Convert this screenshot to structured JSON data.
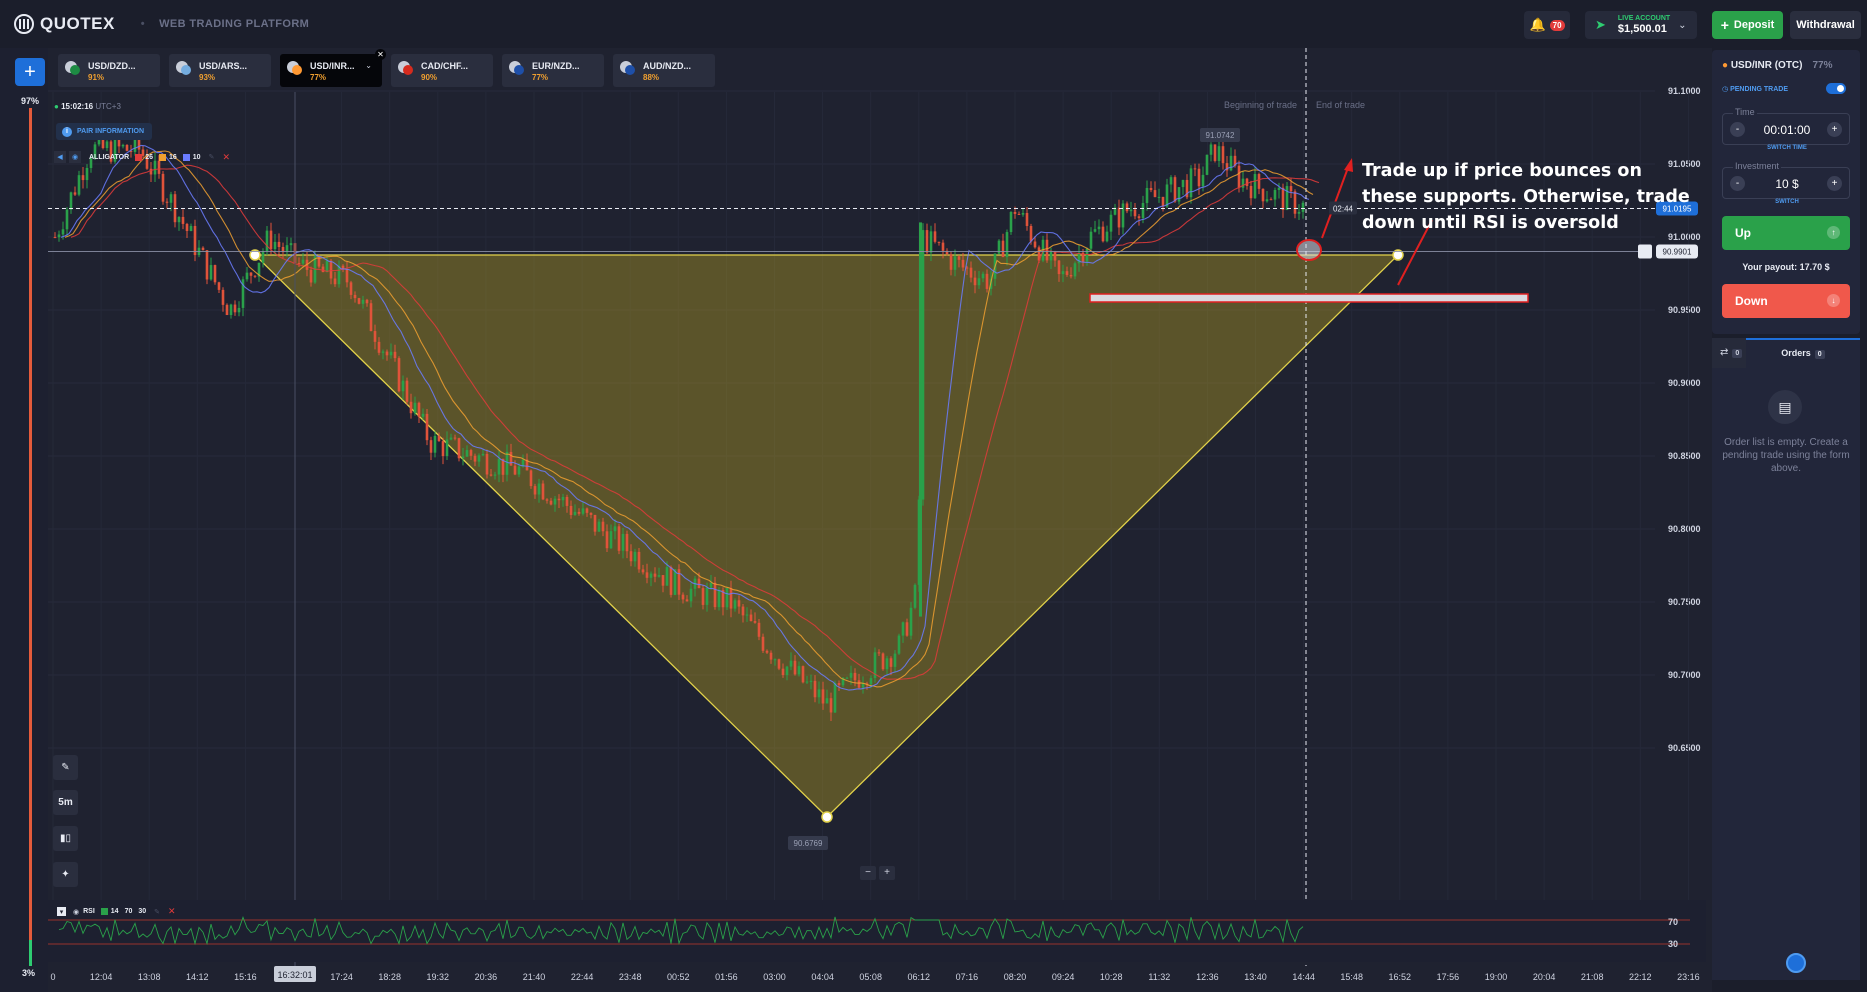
{
  "header": {
    "logo_text": "QUOTEX",
    "platform": "WEB TRADING PLATFORM",
    "notifications_count": "70",
    "account_label": "LIVE ACCOUNT",
    "balance": "$1,500.01",
    "deposit_label": "Deposit",
    "withdrawal_label": "Withdrawal"
  },
  "sentiment": {
    "top": "97%",
    "bottom": "3%"
  },
  "tabs": [
    {
      "name": "USD/DZD...",
      "payout": "91%",
      "flag_color": "#1d8b43"
    },
    {
      "name": "USD/ARS...",
      "payout": "93%",
      "flag_color": "#74acdf"
    },
    {
      "name": "USD/INR...",
      "payout": "77%",
      "flag_color": "#ff9933",
      "active": true
    },
    {
      "name": "CAD/CHF...",
      "payout": "90%",
      "flag_color": "#d52b1e"
    },
    {
      "name": "EUR/NZD...",
      "payout": "77%",
      "flag_color": "#1e4fa8"
    },
    {
      "name": "AUD/NZD...",
      "payout": "88%",
      "flag_color": "#1e4fa8"
    }
  ],
  "chart": {
    "clock": "15:02:16",
    "timezone": "UTC+3",
    "pair_info": "PAIR INFORMATION",
    "indicator": {
      "name": "ALLIGATOR",
      "p1": "26",
      "p2": "16",
      "p3": "10",
      "c1": "#e23b3b",
      "c2": "#f0a030",
      "c3": "#6b7cff"
    },
    "rsi": {
      "name": "RSI",
      "period": "14",
      "upper": "70",
      "lower": "30"
    },
    "timeframe": "5m",
    "beginning_label": "Beginning of trade",
    "end_label": "End of trade",
    "current_price": "91.0195",
    "alert_price": "90.9901",
    "timer": "02:44",
    "high_label": "91.0742",
    "low_label": "90.6769",
    "hover_time": "16:32:01",
    "price_ticks": [
      "91.1000",
      "91.0500",
      "91.0000",
      "90.9500",
      "90.9000",
      "90.8500",
      "90.8000",
      "90.7500",
      "90.7000",
      "90.6500"
    ],
    "time_ticks": [
      "0",
      "12:04",
      "13:08",
      "14:12",
      "15:16",
      "17:24",
      "18:28",
      "19:32",
      "20:36",
      "21:40",
      "22:44",
      "23:48",
      "00:52",
      "01:56",
      "03:00",
      "04:04",
      "05:08",
      "06:12",
      "07:16",
      "08:20",
      "09:24",
      "10:28",
      "11:32",
      "12:36",
      "13:40",
      "14:44",
      "15:48",
      "16:52",
      "17:56",
      "19:00",
      "20:04",
      "21:08",
      "22:12",
      "23:16"
    ],
    "annotation": "Trade up if price bounces on these supports. Otherwise, trade down until RSI is oversold"
  },
  "trade": {
    "asset": "USD/INR (OTC)",
    "asset_payout": "77%",
    "pending_label": "PENDING TRADE",
    "time_label": "Time",
    "time_value": "00:01:00",
    "switch_time": "SWITCH TIME",
    "investment_label": "Investment",
    "investment_value": "10 $",
    "switch": "SWITCH",
    "up_label": "Up",
    "payout_text": "Your payout: 17.70 $",
    "down_label": "Down",
    "history_count": "0",
    "orders_label": "Orders",
    "orders_count": "0",
    "empty_text": "Order list is empty. Create a pending trade using the form above."
  }
}
